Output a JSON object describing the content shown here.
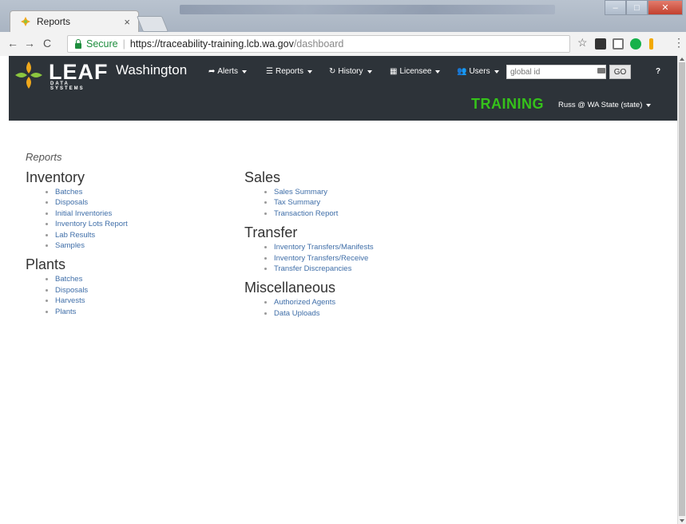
{
  "browser": {
    "tab_title": "Reports",
    "tab_close": "×",
    "secure_label": "Secure",
    "url_host": "https://traceability-training.lcb.wa.gov",
    "url_path": "/dashboard",
    "window_buttons": [
      "–",
      "□",
      "✕"
    ],
    "back": "←",
    "forward": "→",
    "reload": "C",
    "star": "☆",
    "menu": "⋮"
  },
  "nav": {
    "logo": "LEAF",
    "logo_sub": "DATA SYSTEMS",
    "state": "Washington",
    "menus": {
      "alerts": "Alerts",
      "reports": "Reports",
      "history": "History",
      "licensee": "Licensee",
      "users": "Users"
    },
    "search_placeholder": "global id",
    "go": "GO",
    "help": "?",
    "training": "TRAINING",
    "user": "Russ @ WA State (state)"
  },
  "page": {
    "title": "Reports",
    "left_sections": [
      {
        "heading": "Inventory",
        "items": [
          "Batches",
          "Disposals",
          "Initial Inventories",
          "Inventory Lots Report",
          "Lab Results",
          "Samples"
        ]
      },
      {
        "heading": "Plants",
        "items": [
          "Batches",
          "Disposals",
          "Harvests",
          "Plants"
        ]
      }
    ],
    "right_sections": [
      {
        "heading": "Sales",
        "items": [
          "Sales Summary",
          "Tax Summary",
          "Transaction Report"
        ]
      },
      {
        "heading": "Transfer",
        "items": [
          "Inventory Transfers/Manifests",
          "Inventory Transfers/Receive",
          "Transfer Discrepancies"
        ]
      },
      {
        "heading": "Miscellaneous",
        "items": [
          "Authorized Agents",
          "Data Uploads"
        ]
      }
    ]
  },
  "colors": {
    "nav_bg": "#2d3339",
    "training_green": "#35c21a",
    "link": "#3f6ea8",
    "secure_green": "#1e8e3e"
  }
}
